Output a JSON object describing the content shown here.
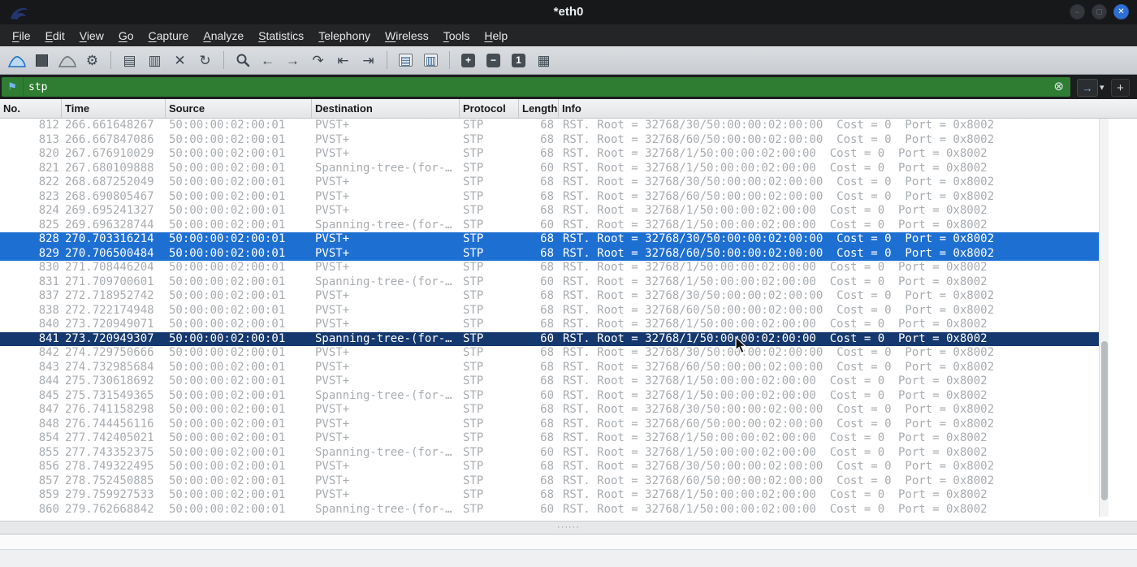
{
  "window": {
    "title": "*eth0",
    "button_glyphs": {
      "minimize": "−",
      "maximize": "▢",
      "close": "✕"
    }
  },
  "menu": {
    "items": [
      "File",
      "Edit",
      "View",
      "Go",
      "Capture",
      "Analyze",
      "Statistics",
      "Telephony",
      "Wireless",
      "Tools",
      "Help"
    ]
  },
  "toolbar": {
    "items": [
      {
        "name": "start-capture-icon",
        "kind": "fin-blue"
      },
      {
        "name": "stop-capture-icon",
        "kind": "square-stop"
      },
      {
        "name": "restart-capture-icon",
        "kind": "fin-gray"
      },
      {
        "name": "capture-options-icon",
        "kind": "glyph",
        "glyph": "⚙"
      },
      {
        "name": "toolbar-separator",
        "kind": "sep"
      },
      {
        "name": "open-file-icon",
        "kind": "glyph",
        "glyph": "▤"
      },
      {
        "name": "save-file-icon",
        "kind": "glyph",
        "glyph": "▥"
      },
      {
        "name": "close-file-icon",
        "kind": "glyph",
        "glyph": "✕"
      },
      {
        "name": "reload-icon",
        "kind": "glyph",
        "glyph": "↻"
      },
      {
        "name": "toolbar-separator",
        "kind": "sep"
      },
      {
        "name": "find-packet-icon",
        "kind": "magnifier"
      },
      {
        "name": "go-back-icon",
        "kind": "glyph",
        "glyph": "←"
      },
      {
        "name": "go-forward-icon",
        "kind": "glyph",
        "glyph": "→"
      },
      {
        "name": "go-to-packet-icon",
        "kind": "glyph",
        "glyph": "↷"
      },
      {
        "name": "go-first-packet-icon",
        "kind": "glyph",
        "glyph": "⇤"
      },
      {
        "name": "go-last-packet-icon",
        "kind": "glyph",
        "glyph": "⇥"
      },
      {
        "name": "toolbar-separator",
        "kind": "sep"
      },
      {
        "name": "colorize-list-icon",
        "kind": "glyph-framed",
        "glyph": "▤"
      },
      {
        "name": "autoscroll-icon",
        "kind": "glyph-framed",
        "glyph": "▥"
      },
      {
        "name": "toolbar-separator",
        "kind": "sep"
      },
      {
        "name": "zoom-in-icon",
        "kind": "darkbtn",
        "glyph": "+"
      },
      {
        "name": "zoom-out-icon",
        "kind": "darkbtn",
        "glyph": "−"
      },
      {
        "name": "zoom-100-icon",
        "kind": "darkbtn",
        "glyph": "1"
      },
      {
        "name": "resize-columns-icon",
        "kind": "glyph",
        "glyph": "▦"
      }
    ]
  },
  "filter": {
    "value": "stp",
    "icons": {
      "bookmark": "⚑",
      "clear": "⊗",
      "apply": "→",
      "caret": "▾"
    },
    "add_label": "+"
  },
  "table": {
    "columns": [
      "No.",
      "Time",
      "Source",
      "Destination",
      "Protocol",
      "Length",
      "Info"
    ],
    "rows": [
      {
        "no": "812",
        "time": "266.661648267",
        "src": "50:00:00:02:00:01",
        "dst": "PVST+",
        "proto": "STP",
        "len": "68",
        "info": "RST. Root = 32768/30/50:00:00:02:00:00  Cost = 0  Port = 0x8002",
        "state": "normal"
      },
      {
        "no": "813",
        "time": "266.667847086",
        "src": "50:00:00:02:00:01",
        "dst": "PVST+",
        "proto": "STP",
        "len": "68",
        "info": "RST. Root = 32768/60/50:00:00:02:00:00  Cost = 0  Port = 0x8002",
        "state": "normal"
      },
      {
        "no": "820",
        "time": "267.676910029",
        "src": "50:00:00:02:00:01",
        "dst": "PVST+",
        "proto": "STP",
        "len": "68",
        "info": "RST. Root = 32768/1/50:00:00:02:00:00  Cost = 0  Port = 0x8002",
        "state": "normal"
      },
      {
        "no": "821",
        "time": "267.680109888",
        "src": "50:00:00:02:00:01",
        "dst": "Spanning-tree-(for-…",
        "proto": "STP",
        "len": "60",
        "info": "RST. Root = 32768/1/50:00:00:02:00:00  Cost = 0  Port = 0x8002",
        "state": "normal"
      },
      {
        "no": "822",
        "time": "268.687252049",
        "src": "50:00:00:02:00:01",
        "dst": "PVST+",
        "proto": "STP",
        "len": "68",
        "info": "RST. Root = 32768/30/50:00:00:02:00:00  Cost = 0  Port = 0x8002",
        "state": "normal"
      },
      {
        "no": "823",
        "time": "268.690805467",
        "src": "50:00:00:02:00:01",
        "dst": "PVST+",
        "proto": "STP",
        "len": "68",
        "info": "RST. Root = 32768/60/50:00:00:02:00:00  Cost = 0  Port = 0x8002",
        "state": "normal"
      },
      {
        "no": "824",
        "time": "269.695241327",
        "src": "50:00:00:02:00:01",
        "dst": "PVST+",
        "proto": "STP",
        "len": "68",
        "info": "RST. Root = 32768/1/50:00:00:02:00:00  Cost = 0  Port = 0x8002",
        "state": "normal"
      },
      {
        "no": "825",
        "time": "269.696328744",
        "src": "50:00:00:02:00:01",
        "dst": "Spanning-tree-(for-…",
        "proto": "STP",
        "len": "60",
        "info": "RST. Root = 32768/1/50:00:00:02:00:00  Cost = 0  Port = 0x8002",
        "state": "normal"
      },
      {
        "no": "828",
        "time": "270.703316214",
        "src": "50:00:00:02:00:01",
        "dst": "PVST+",
        "proto": "STP",
        "len": "68",
        "info": "RST. Root = 32768/30/50:00:00:02:00:00  Cost = 0  Port = 0x8002",
        "state": "selected"
      },
      {
        "no": "829",
        "time": "270.706500484",
        "src": "50:00:00:02:00:01",
        "dst": "PVST+",
        "proto": "STP",
        "len": "68",
        "info": "RST. Root = 32768/60/50:00:00:02:00:00  Cost = 0  Port = 0x8002",
        "state": "selected"
      },
      {
        "no": "830",
        "time": "271.708446204",
        "src": "50:00:00:02:00:01",
        "dst": "PVST+",
        "proto": "STP",
        "len": "68",
        "info": "RST. Root = 32768/1/50:00:00:02:00:00  Cost = 0  Port = 0x8002",
        "state": "normal"
      },
      {
        "no": "831",
        "time": "271.709700601",
        "src": "50:00:00:02:00:01",
        "dst": "Spanning-tree-(for-…",
        "proto": "STP",
        "len": "60",
        "info": "RST. Root = 32768/1/50:00:00:02:00:00  Cost = 0  Port = 0x8002",
        "state": "normal"
      },
      {
        "no": "837",
        "time": "272.718952742",
        "src": "50:00:00:02:00:01",
        "dst": "PVST+",
        "proto": "STP",
        "len": "68",
        "info": "RST. Root = 32768/30/50:00:00:02:00:00  Cost = 0  Port = 0x8002",
        "state": "normal"
      },
      {
        "no": "838",
        "time": "272.722174948",
        "src": "50:00:00:02:00:01",
        "dst": "PVST+",
        "proto": "STP",
        "len": "68",
        "info": "RST. Root = 32768/60/50:00:00:02:00:00  Cost = 0  Port = 0x8002",
        "state": "normal"
      },
      {
        "no": "840",
        "time": "273.720949071",
        "src": "50:00:00:02:00:01",
        "dst": "PVST+",
        "proto": "STP",
        "len": "68",
        "info": "RST. Root = 32768/1/50:00:00:02:00:00  Cost = 0  Port = 0x8002",
        "state": "normal"
      },
      {
        "no": "841",
        "time": "273.720949307",
        "src": "50:00:00:02:00:01",
        "dst": "Spanning-tree-(for-…",
        "proto": "STP",
        "len": "60",
        "info": "RST. Root = 32768/1/50:00:00:02:00:00  Cost = 0  Port = 0x8002",
        "state": "focused"
      },
      {
        "no": "842",
        "time": "274.729750666",
        "src": "50:00:00:02:00:01",
        "dst": "PVST+",
        "proto": "STP",
        "len": "68",
        "info": "RST. Root = 32768/30/50:00:00:02:00:00  Cost = 0  Port = 0x8002",
        "state": "normal"
      },
      {
        "no": "843",
        "time": "274.732985684",
        "src": "50:00:00:02:00:01",
        "dst": "PVST+",
        "proto": "STP",
        "len": "68",
        "info": "RST. Root = 32768/60/50:00:00:02:00:00  Cost = 0  Port = 0x8002",
        "state": "normal"
      },
      {
        "no": "844",
        "time": "275.730618692",
        "src": "50:00:00:02:00:01",
        "dst": "PVST+",
        "proto": "STP",
        "len": "68",
        "info": "RST. Root = 32768/1/50:00:00:02:00:00  Cost = 0  Port = 0x8002",
        "state": "normal"
      },
      {
        "no": "845",
        "time": "275.731549365",
        "src": "50:00:00:02:00:01",
        "dst": "Spanning-tree-(for-…",
        "proto": "STP",
        "len": "60",
        "info": "RST. Root = 32768/1/50:00:00:02:00:00  Cost = 0  Port = 0x8002",
        "state": "normal"
      },
      {
        "no": "847",
        "time": "276.741158298",
        "src": "50:00:00:02:00:01",
        "dst": "PVST+",
        "proto": "STP",
        "len": "68",
        "info": "RST. Root = 32768/30/50:00:00:02:00:00  Cost = 0  Port = 0x8002",
        "state": "normal"
      },
      {
        "no": "848",
        "time": "276.744456116",
        "src": "50:00:00:02:00:01",
        "dst": "PVST+",
        "proto": "STP",
        "len": "68",
        "info": "RST. Root = 32768/60/50:00:00:02:00:00  Cost = 0  Port = 0x8002",
        "state": "normal"
      },
      {
        "no": "854",
        "time": "277.742405021",
        "src": "50:00:00:02:00:01",
        "dst": "PVST+",
        "proto": "STP",
        "len": "68",
        "info": "RST. Root = 32768/1/50:00:00:02:00:00  Cost = 0  Port = 0x8002",
        "state": "normal"
      },
      {
        "no": "855",
        "time": "277.743352375",
        "src": "50:00:00:02:00:01",
        "dst": "Spanning-tree-(for-…",
        "proto": "STP",
        "len": "60",
        "info": "RST. Root = 32768/1/50:00:00:02:00:00  Cost = 0  Port = 0x8002",
        "state": "normal"
      },
      {
        "no": "856",
        "time": "278.749322495",
        "src": "50:00:00:02:00:01",
        "dst": "PVST+",
        "proto": "STP",
        "len": "68",
        "info": "RST. Root = 32768/30/50:00:00:02:00:00  Cost = 0  Port = 0x8002",
        "state": "normal"
      },
      {
        "no": "857",
        "time": "278.752450885",
        "src": "50:00:00:02:00:01",
        "dst": "PVST+",
        "proto": "STP",
        "len": "68",
        "info": "RST. Root = 32768/60/50:00:00:02:00:00  Cost = 0  Port = 0x8002",
        "state": "normal"
      },
      {
        "no": "859",
        "time": "279.759927533",
        "src": "50:00:00:02:00:01",
        "dst": "PVST+",
        "proto": "STP",
        "len": "68",
        "info": "RST. Root = 32768/1/50:00:00:02:00:00  Cost = 0  Port = 0x8002",
        "state": "normal"
      },
      {
        "no": "860",
        "time": "279.762668842",
        "src": "50:00:00:02:00:01",
        "dst": "Spanning-tree-(for-…",
        "proto": "STP",
        "len": "60",
        "info": "RST. Root = 32768/1/50:00:00:02:00:00  Cost = 0  Port = 0x8002",
        "state": "normal"
      }
    ]
  },
  "splitter": {
    "handle_dots": "······"
  },
  "colors": {
    "filter_valid_green": "#2e7d32",
    "row_text_gray": "#a8acb0",
    "selected_row_blue": "#1e6fd2",
    "focused_row_navy": "#15386e",
    "titlebar_dark": "#17181a"
  }
}
